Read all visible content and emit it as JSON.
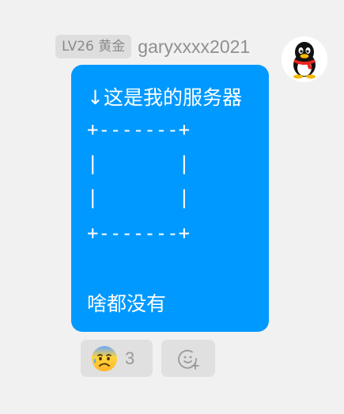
{
  "message": {
    "level_badge": "LV26 黄金",
    "username": "garyxxxx2021",
    "title": "↓这是我的服务器",
    "ascii_art": [
      "+-------+",
      "|       |",
      "|       |",
      "+-------+"
    ],
    "footer": "啥都没有"
  },
  "reactions": [
    {
      "icon": "anxious-sweat-face-emoji-icon",
      "count": "3"
    }
  ],
  "add_reaction": {
    "icon": "add-emoji-icon"
  },
  "avatar": {
    "icon": "qq-penguin-avatar-icon"
  },
  "colors": {
    "background": "#f1f1f1",
    "bubble": "#0099ff",
    "badge_bg": "#dedede",
    "reaction_bg": "#e0e0e0"
  }
}
